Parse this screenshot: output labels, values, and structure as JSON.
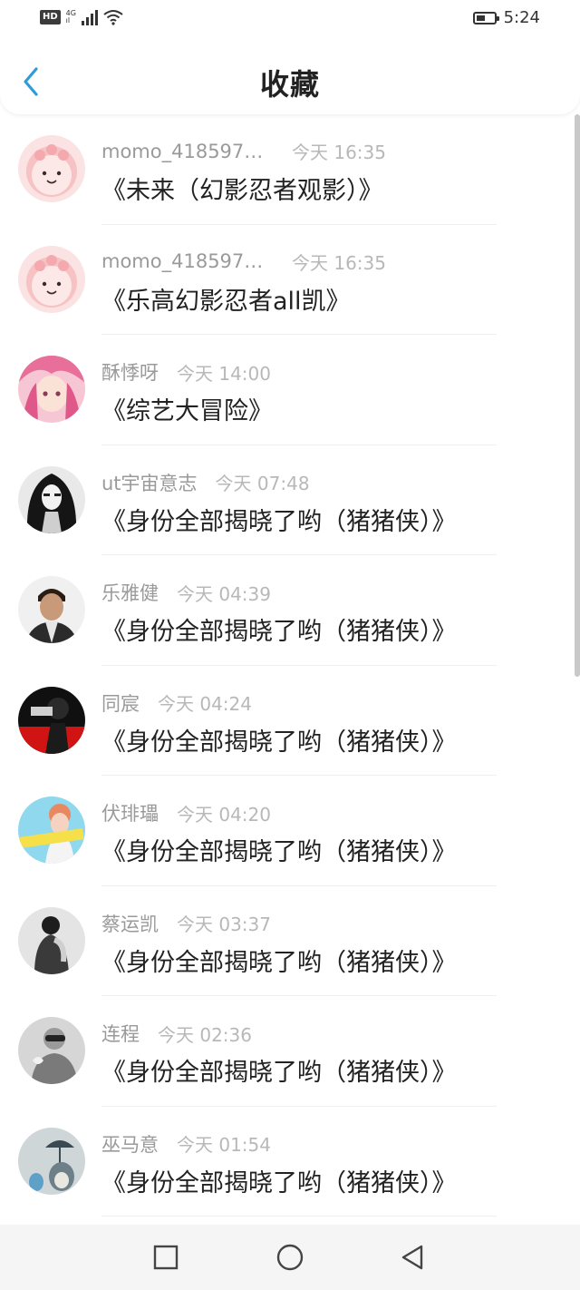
{
  "status_bar": {
    "hd": "HD",
    "network_type": "4G",
    "network_sub": "ıl",
    "time": "5:24",
    "signal_icon": "cell-signal-icon",
    "wifi_icon": "wifi-icon",
    "battery_icon": "battery-icon"
  },
  "header": {
    "title": "收藏",
    "back_icon": "back-arrow-icon",
    "accent": "#2f9bd8"
  },
  "items": [
    {
      "user": "momo_4185973...",
      "time": "今天 16:35",
      "title": "《未来（幻影忍者观影）》",
      "avatar": "pink-mascot"
    },
    {
      "user": "momo_4185973...",
      "time": "今天 16:35",
      "title": "《乐高幻影忍者all凯》",
      "avatar": "pink-mascot"
    },
    {
      "user": "酥悸呀",
      "time": "今天 14:00",
      "title": "《综艺大冒险》",
      "avatar": "pink-hair-anime"
    },
    {
      "user": "ut宇宙意志",
      "time": "今天 07:48",
      "title": "《身份全部揭晓了哟（猪猪侠）》",
      "avatar": "dark-hair-figure"
    },
    {
      "user": "乐雅健",
      "time": "今天 04:39",
      "title": "《身份全部揭晓了哟（猪猪侠）》",
      "avatar": "man-portrait"
    },
    {
      "user": "同宸",
      "time": "今天 04:24",
      "title": "《身份全部揭晓了哟（猪猪侠）》",
      "avatar": "red-black-figure"
    },
    {
      "user": "伏琲瓃",
      "time": "今天 04:20",
      "title": "《身份全部揭晓了哟（猪猪侠）》",
      "avatar": "cyan-sticker"
    },
    {
      "user": "蔡运凯",
      "time": "今天 03:37",
      "title": "《身份全部揭晓了哟（猪猪侠）》",
      "avatar": "bw-figure"
    },
    {
      "user": "连程",
      "time": "今天 02:36",
      "title": "《身份全部揭晓了哟（猪猪侠）》",
      "avatar": "grey-figure"
    },
    {
      "user": "巫马意",
      "time": "今天 01:54",
      "title": "《身份全部揭晓了哟（猪猪侠）》",
      "avatar": "totoro-umbrella"
    }
  ],
  "nav_bar": {
    "recent_icon": "square-recents-icon",
    "home_icon": "circle-home-icon",
    "back_icon": "triangle-back-icon"
  }
}
